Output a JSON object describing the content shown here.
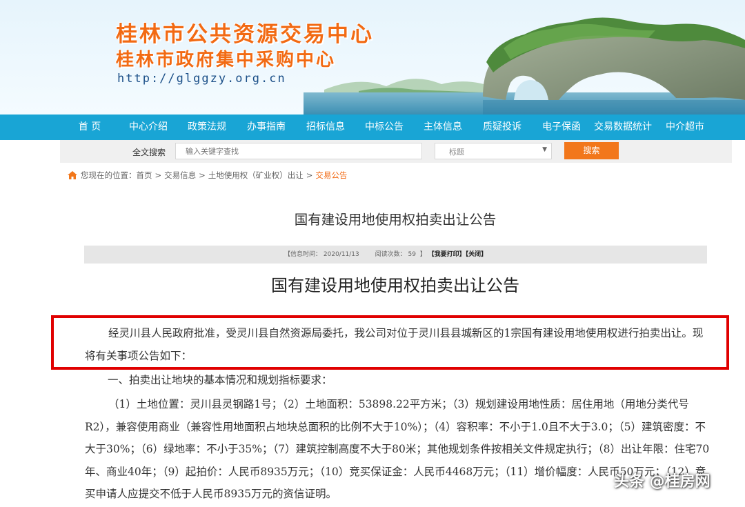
{
  "header": {
    "title_main": "桂林市公共资源交易中心",
    "title_sub": "桂林市政府集中采购中心",
    "url": "http://glggzy.org.cn"
  },
  "nav": {
    "items": [
      {
        "label": "首 页"
      },
      {
        "label": "中心介绍"
      },
      {
        "label": "政策法规"
      },
      {
        "label": "办事指南"
      },
      {
        "label": "招标信息"
      },
      {
        "label": "中标公告"
      },
      {
        "label": "主体信息"
      },
      {
        "label": "质疑投诉"
      },
      {
        "label": "电子保函"
      },
      {
        "label": "交易数据统计"
      },
      {
        "label": "中介超市"
      }
    ]
  },
  "search": {
    "label": "全文搜索",
    "placeholder": "输入关键字查找",
    "select_value": "标题",
    "button": "搜索"
  },
  "breadcrumb": {
    "prefix": "您现在的位置：",
    "items": [
      "首页",
      "交易信息",
      "土地使用权（矿业权）出让",
      "交易公告"
    ],
    "separator": ">"
  },
  "article": {
    "page_title": "国有建设用地使用权拍卖出让公告",
    "info_time_label": "【信息时间：",
    "info_time": "2020/11/13",
    "views_label": "阅读次数：",
    "views": "59",
    "print_label": "【我要打印】",
    "close_label": "【关闭】",
    "title": "国有建设用地使用权拍卖出让公告",
    "intro": "经灵川县人民政府批准，受灵川县自然资源局委托，我公司对位于灵川县县城新区的1宗国有建设用地使用权进行拍卖出让。现将有关事项公告如下：",
    "section1_heading": "一、拍卖出让地块的基本情况和规划指标要求：",
    "section1_body": "（1）土地位置：灵川县灵钢路1号；（2）土地面积：53898.22平方米；（3）规划建设用地性质：居住用地（用地分类代号R2），兼容使用商业（兼容性用地面积占地块总面积的比例不大于10%）；（4）容积率：不小于1.0且不大于3.0；（5）建筑密度：不大于30%；（6）绿地率：不小于35%；（7）建筑控制高度不大于80米；其他规划条件按相关文件规定执行；（8）出让年限：住宅70年、商业40年；（9）起拍价：人民币8935万元；（10）竞买保证金：人民币4468万元；（11）增价幅度：人民币50万元；（12）竞买申请人应提交不低于人民币8935万元的资信证明。"
  },
  "watermark": "头条 @桂房网",
  "colors": {
    "nav_bg": "#19a5d5",
    "title_orange": "#f26a13",
    "search_button": "#f2771b",
    "highlight_border": "#e00000"
  }
}
